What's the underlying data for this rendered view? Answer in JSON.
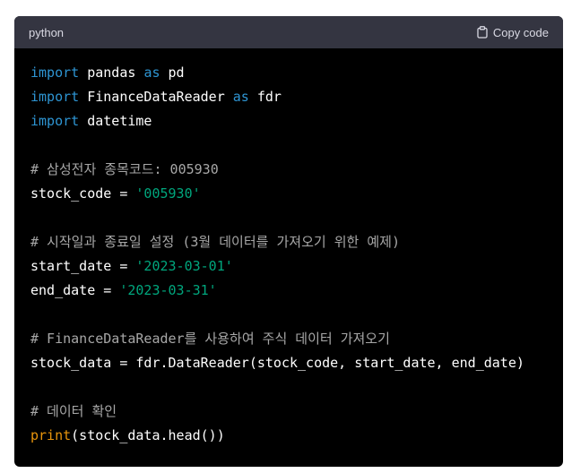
{
  "header": {
    "language": "python",
    "copy_label": "Copy code"
  },
  "colors": {
    "keyword": "#2e95d3",
    "string": "#00a67d",
    "comment": "#a7a7a7",
    "builtin": "#e9950c",
    "plain": "#ffffff",
    "header_bg": "#343541",
    "code_bg": "#000000"
  },
  "icons": {
    "copy": "clipboard-icon"
  },
  "code_lines": [
    [
      [
        "keyword",
        "import"
      ],
      [
        "plain",
        " pandas "
      ],
      [
        "keyword",
        "as"
      ],
      [
        "plain",
        " pd"
      ]
    ],
    [
      [
        "keyword",
        "import"
      ],
      [
        "plain",
        " FinanceDataReader "
      ],
      [
        "keyword",
        "as"
      ],
      [
        "plain",
        " fdr"
      ]
    ],
    [
      [
        "keyword",
        "import"
      ],
      [
        "plain",
        " datetime"
      ]
    ],
    [],
    [
      [
        "comment",
        "# 삼성전자 종목코드: 005930"
      ]
    ],
    [
      [
        "plain",
        "stock_code = "
      ],
      [
        "string",
        "'005930'"
      ]
    ],
    [],
    [
      [
        "comment",
        "# 시작일과 종료일 설정 (3월 데이터를 가져오기 위한 예제)"
      ]
    ],
    [
      [
        "plain",
        "start_date = "
      ],
      [
        "string",
        "'2023-03-01'"
      ]
    ],
    [
      [
        "plain",
        "end_date = "
      ],
      [
        "string",
        "'2023-03-31'"
      ]
    ],
    [],
    [
      [
        "comment",
        "# FinanceDataReader를 사용하여 주식 데이터 가져오기"
      ]
    ],
    [
      [
        "plain",
        "stock_data = fdr.DataReader(stock_code, start_date, end_date)"
      ]
    ],
    [],
    [
      [
        "comment",
        "# 데이터 확인"
      ]
    ],
    [
      [
        "builtin",
        "print"
      ],
      [
        "plain",
        "(stock_data.head())"
      ]
    ]
  ]
}
